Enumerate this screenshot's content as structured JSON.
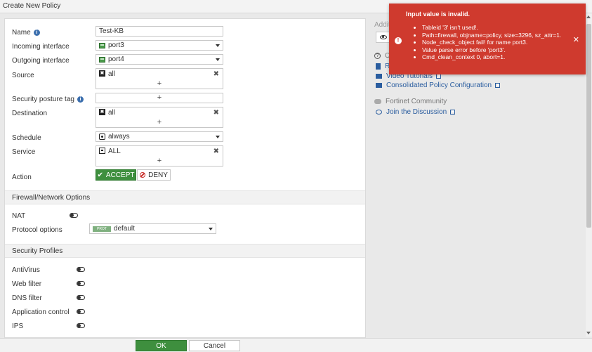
{
  "window": {
    "title": "Create New Policy"
  },
  "form": {
    "name": {
      "label": "Name",
      "value": "Test-KB"
    },
    "incoming_interface": {
      "label": "Incoming interface",
      "value": "port3"
    },
    "outgoing_interface": {
      "label": "Outgoing interface",
      "value": "port4"
    },
    "source": {
      "label": "Source",
      "value": "all"
    },
    "security_posture_tag": {
      "label": "Security posture tag",
      "value": ""
    },
    "destination": {
      "label": "Destination",
      "value": "all"
    },
    "schedule": {
      "label": "Schedule",
      "value": "always"
    },
    "service": {
      "label": "Service",
      "value": "ALL"
    },
    "action": {
      "label": "Action",
      "accept_label": "ACCEPT",
      "deny_label": "DENY",
      "selected": "ACCEPT"
    },
    "plus_glyph": "+",
    "remove_glyph": "✖"
  },
  "firewall_options": {
    "header": "Firewall/Network Options",
    "nat": {
      "label": "NAT",
      "enabled": false
    },
    "protocol_options": {
      "label": "Protocol options",
      "badge": "PROT",
      "value": "default"
    }
  },
  "security_profiles": {
    "header": "Security Profiles",
    "items": [
      {
        "label": "AntiVirus",
        "enabled": false
      },
      {
        "label": "Web filter",
        "enabled": false
      },
      {
        "label": "DNS filter",
        "enabled": false
      },
      {
        "label": "Application control",
        "enabled": false
      },
      {
        "label": "IPS",
        "enabled": false
      }
    ]
  },
  "sidebar": {
    "additional_info_partial": "Addit",
    "help_partial": "O",
    "doc_link_partial": "R",
    "video_tutorials": "Video Tutorials",
    "consolidated_policy": "Consolidated Policy Configuration",
    "community_header": "Fortinet Community",
    "join_discussion": "Join the Discussion"
  },
  "footer": {
    "ok_label": "OK",
    "cancel_label": "Cancel"
  },
  "toast": {
    "title": "Input value is invalid.",
    "lines": [
      "Tableid '3' isn't used!.",
      "Path=firewall, objname=policy, size=3296, sz_attr=1.",
      "Node_check_object fail! for name port3.",
      "Value parse error before 'port3'.",
      "Cmd_clean_context 0, abort=1."
    ],
    "close_glyph": "✕",
    "icon_glyph": "!"
  },
  "colors": {
    "accept_green": "#3e8f3e",
    "error_red": "#cf3a2e",
    "link_blue": "#2a5d9f"
  }
}
